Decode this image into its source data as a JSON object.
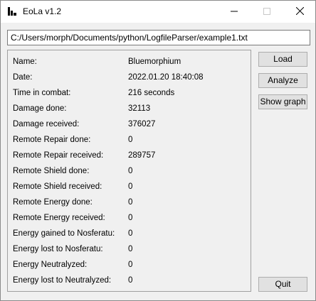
{
  "window": {
    "title": "EoLa v1.2",
    "file_path": "C:/Users/morph/Documents/python/LogfileParser/example1.txt"
  },
  "info": [
    {
      "label": "Name:",
      "value": "Bluemorphium"
    },
    {
      "label": "Date:",
      "value": "2022.01.20 18:40:08"
    },
    {
      "label": "Time in combat:",
      "value": "216 seconds"
    },
    {
      "label": "Damage done:",
      "value": "32113"
    },
    {
      "label": "Damage received:",
      "value": "376027"
    },
    {
      "label": "Remote Repair done:",
      "value": "0"
    },
    {
      "label": "Remote Repair received:",
      "value": "289757"
    },
    {
      "label": "Remote Shield done:",
      "value": "0"
    },
    {
      "label": "Remote Shield received:",
      "value": "0"
    },
    {
      "label": "Remote Energy done:",
      "value": "0"
    },
    {
      "label": "Remote Energy received:",
      "value": "0"
    },
    {
      "label": "Energy gained to Nosferatu:",
      "value": "0"
    },
    {
      "label": "Energy lost to Nosferatu:",
      "value": "0"
    },
    {
      "label": "Energy Neutralyzed:",
      "value": "0"
    },
    {
      "label": "Energy lost to Neutralyzed:",
      "value": "0"
    }
  ],
  "buttons": {
    "load": "Load",
    "analyze": "Analyze",
    "show_graph": "Show graph",
    "quit": "Quit"
  },
  "icons": {
    "app": "app-logo-icon",
    "minimize": "minimize-icon",
    "maximize": "maximize-icon",
    "close": "close-icon"
  }
}
